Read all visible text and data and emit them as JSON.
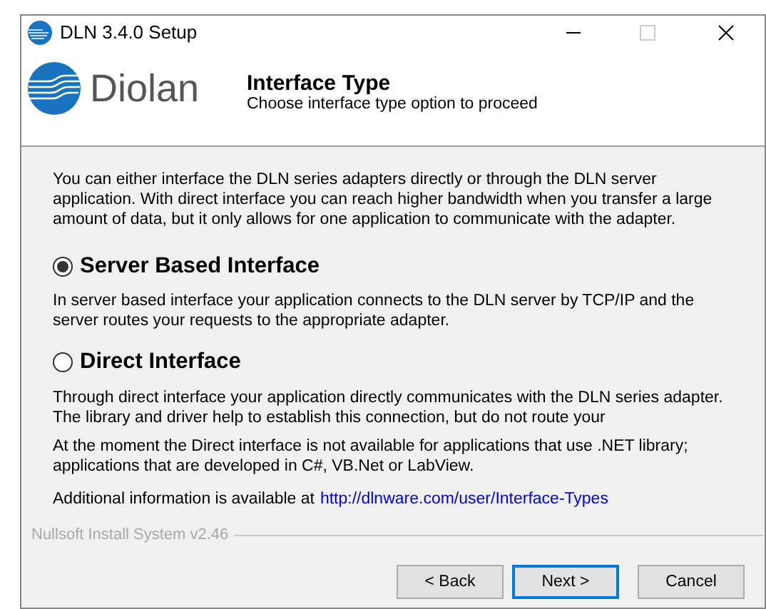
{
  "window": {
    "title": "DLN 3.4.0 Setup"
  },
  "header": {
    "logo_text": "Diolan",
    "title": "Interface Type",
    "subtitle": "Choose interface type option to proceed"
  },
  "intro": "You can either interface the DLN series adapters directly or through the DLN server application. With direct interface you can reach higher bandwidth when you transfer a large amount of data, but it only allows for one application to communicate with the adapter.",
  "options": [
    {
      "label": "Server Based Interface",
      "selected": true,
      "description": "In server based interface your application connects to the DLN server by TCP/IP and the server routes your requests to the appropriate adapter."
    },
    {
      "label": "Direct Interface",
      "selected": false,
      "description": "Through direct interface your application directly communicates with the DLN series adapter. The library and driver help to establish this connection, but do not route your"
    }
  ],
  "note": "At the moment the Direct interface is not available for applications that use .NET library; applications that are developed in C#, VB.Net or LabView.",
  "info": {
    "text": "Additional information is available at",
    "link": "http://dlnware.com/user/Interface-Types"
  },
  "branding": "Nullsoft Install System v2.46",
  "buttons": [
    {
      "label": "< Back",
      "focused": false
    },
    {
      "label": "Next >",
      "focused": true
    },
    {
      "label": "Cancel",
      "focused": false
    }
  ]
}
